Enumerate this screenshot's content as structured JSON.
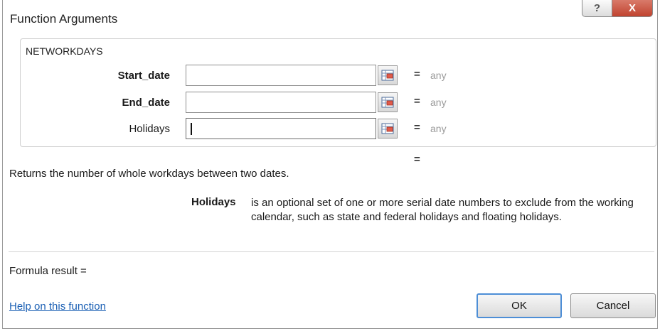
{
  "window": {
    "title": "Function Arguments",
    "help_label": "?",
    "close_label": "X"
  },
  "function": {
    "name": "NETWORKDAYS",
    "arguments": [
      {
        "label": "Start_date",
        "value": "",
        "hint": "any",
        "bold": true
      },
      {
        "label": "End_date",
        "value": "",
        "hint": "any",
        "bold": true
      },
      {
        "label": "Holidays",
        "value": "",
        "hint": "any",
        "bold": false
      }
    ],
    "equals_sign": "=",
    "result_equals": "=",
    "description": "Returns the number of whole workdays between two dates.",
    "argument_help": {
      "name": "Holidays",
      "text": "is an optional set of one or more serial date numbers to exclude from the working calendar, such as state and federal holidays and floating holidays."
    }
  },
  "footer": {
    "formula_result_label": "Formula result =",
    "help_link": "Help on this function",
    "ok_label": "OK",
    "cancel_label": "Cancel"
  },
  "icons": {
    "help": "question-mark-icon",
    "close": "close-icon",
    "range_ref": "collapse-dialog-icon"
  },
  "colors": {
    "link": "#1a5fb4",
    "close_button": "#c0432f",
    "ok_focus": "#4d8ed6",
    "hint": "#9a9a9a"
  }
}
